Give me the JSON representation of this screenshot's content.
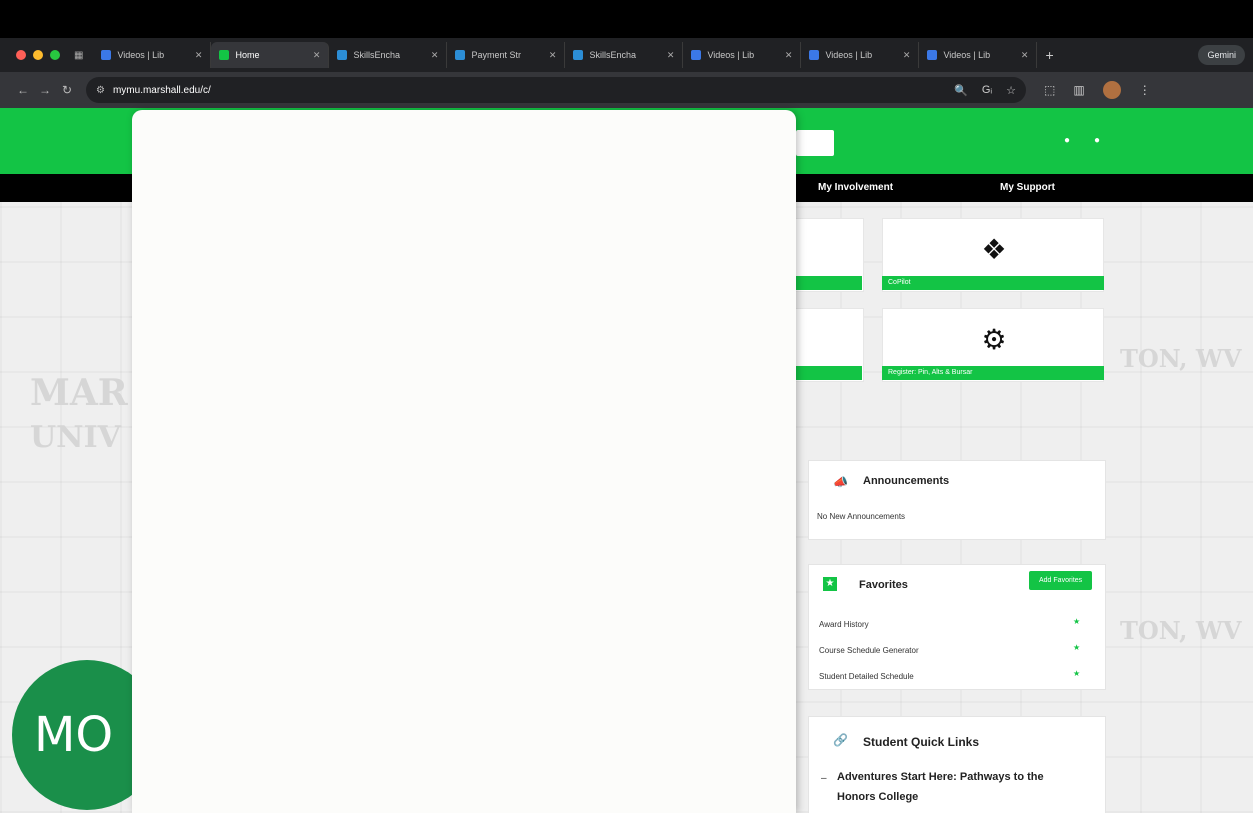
{
  "browser": {
    "tabs": [
      {
        "title": "Videos | Lib",
        "color": "#3b78e7"
      },
      {
        "title": "Home",
        "color": "#13c445"
      },
      {
        "title": "SkillsEncha",
        "color": "#2c8ed6"
      },
      {
        "title": "Payment Str",
        "color": "#2c8ed6"
      },
      {
        "title": "SkillsEncha",
        "color": "#2c8ed6"
      },
      {
        "title": "Videos | Lib",
        "color": "#3b78e7"
      },
      {
        "title": "Videos | Lib",
        "color": "#3b78e7"
      },
      {
        "title": "Videos | Lib",
        "color": "#3b78e7"
      }
    ],
    "gemini_label": "Gemini",
    "url": "mymu.marshall.edu/c/"
  },
  "site": {
    "menu": {
      "involvement": "My Involvement",
      "support": "My Support"
    },
    "tiles": [
      {
        "label": "CoPilot",
        "icon": "copilot-icon"
      },
      {
        "label": "Register: Pin, Alts & Bursar",
        "icon": "gear-icon"
      }
    ],
    "background_text": {
      "marshall": "MAR",
      "university": "UNIV",
      "huntington1": "TON, WV",
      "huntington2": "TON, WV"
    },
    "announcements": {
      "title": "Announcements",
      "body": "No New Announcements"
    },
    "favorites": {
      "title": "Favorites",
      "add_button": "Add Favorites",
      "items": [
        "Award History",
        "Course Schedule Generator",
        "Student Detailed Schedule"
      ]
    },
    "quick_links": {
      "title": "Student Quick Links",
      "items": [
        "Adventures Start Here: Pathways to the Honors College"
      ]
    },
    "avatar_initials": "MO"
  },
  "colors": {
    "brand_green": "#13c445",
    "menu_black": "#000000"
  }
}
